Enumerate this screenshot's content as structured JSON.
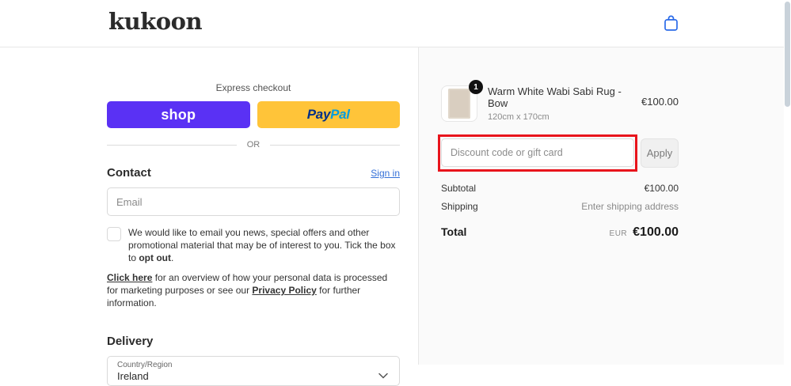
{
  "header": {
    "logo": "kukoon"
  },
  "express": {
    "label": "Express checkout",
    "shop_label": "shop",
    "paypal_pay": "Pay",
    "paypal_pal": "Pal",
    "or": "OR"
  },
  "contact": {
    "heading": "Contact",
    "sign_in": "Sign in",
    "email_placeholder": "Email",
    "optout_text": "We would like to email you news, special offers and other promotional material that may be of interest to you. Tick the box to ",
    "optout_bold": "opt out",
    "optout_end": ".",
    "privacy_link_1": "Click here",
    "privacy_text_1": " for an overview of how your personal data is processed for marketing purposes or see our ",
    "privacy_link_2": "Privacy Policy",
    "privacy_text_2": " for further information."
  },
  "delivery": {
    "heading": "Delivery",
    "country_label": "Country/Region",
    "country_value": "Ireland"
  },
  "summary": {
    "item": {
      "quantity": "1",
      "title": "Warm White Wabi Sabi Rug - Bow",
      "variant": "120cm x 170cm",
      "price": "€100.00"
    },
    "discount": {
      "placeholder": "Discount code or gift card",
      "apply_label": "Apply"
    },
    "subtotal_label": "Subtotal",
    "subtotal_value": "€100.00",
    "shipping_label": "Shipping",
    "shipping_value": "Enter shipping address",
    "total_label": "Total",
    "currency_code": "EUR",
    "total_value": "€100.00"
  },
  "colors": {
    "shop_purple": "#5a31f4",
    "paypal_yellow": "#ffc439",
    "link_blue": "#3470d8",
    "bag_icon_blue": "#2a6ae8",
    "annotation_red": "#e8141c",
    "panel_bg": "#fafafa"
  }
}
